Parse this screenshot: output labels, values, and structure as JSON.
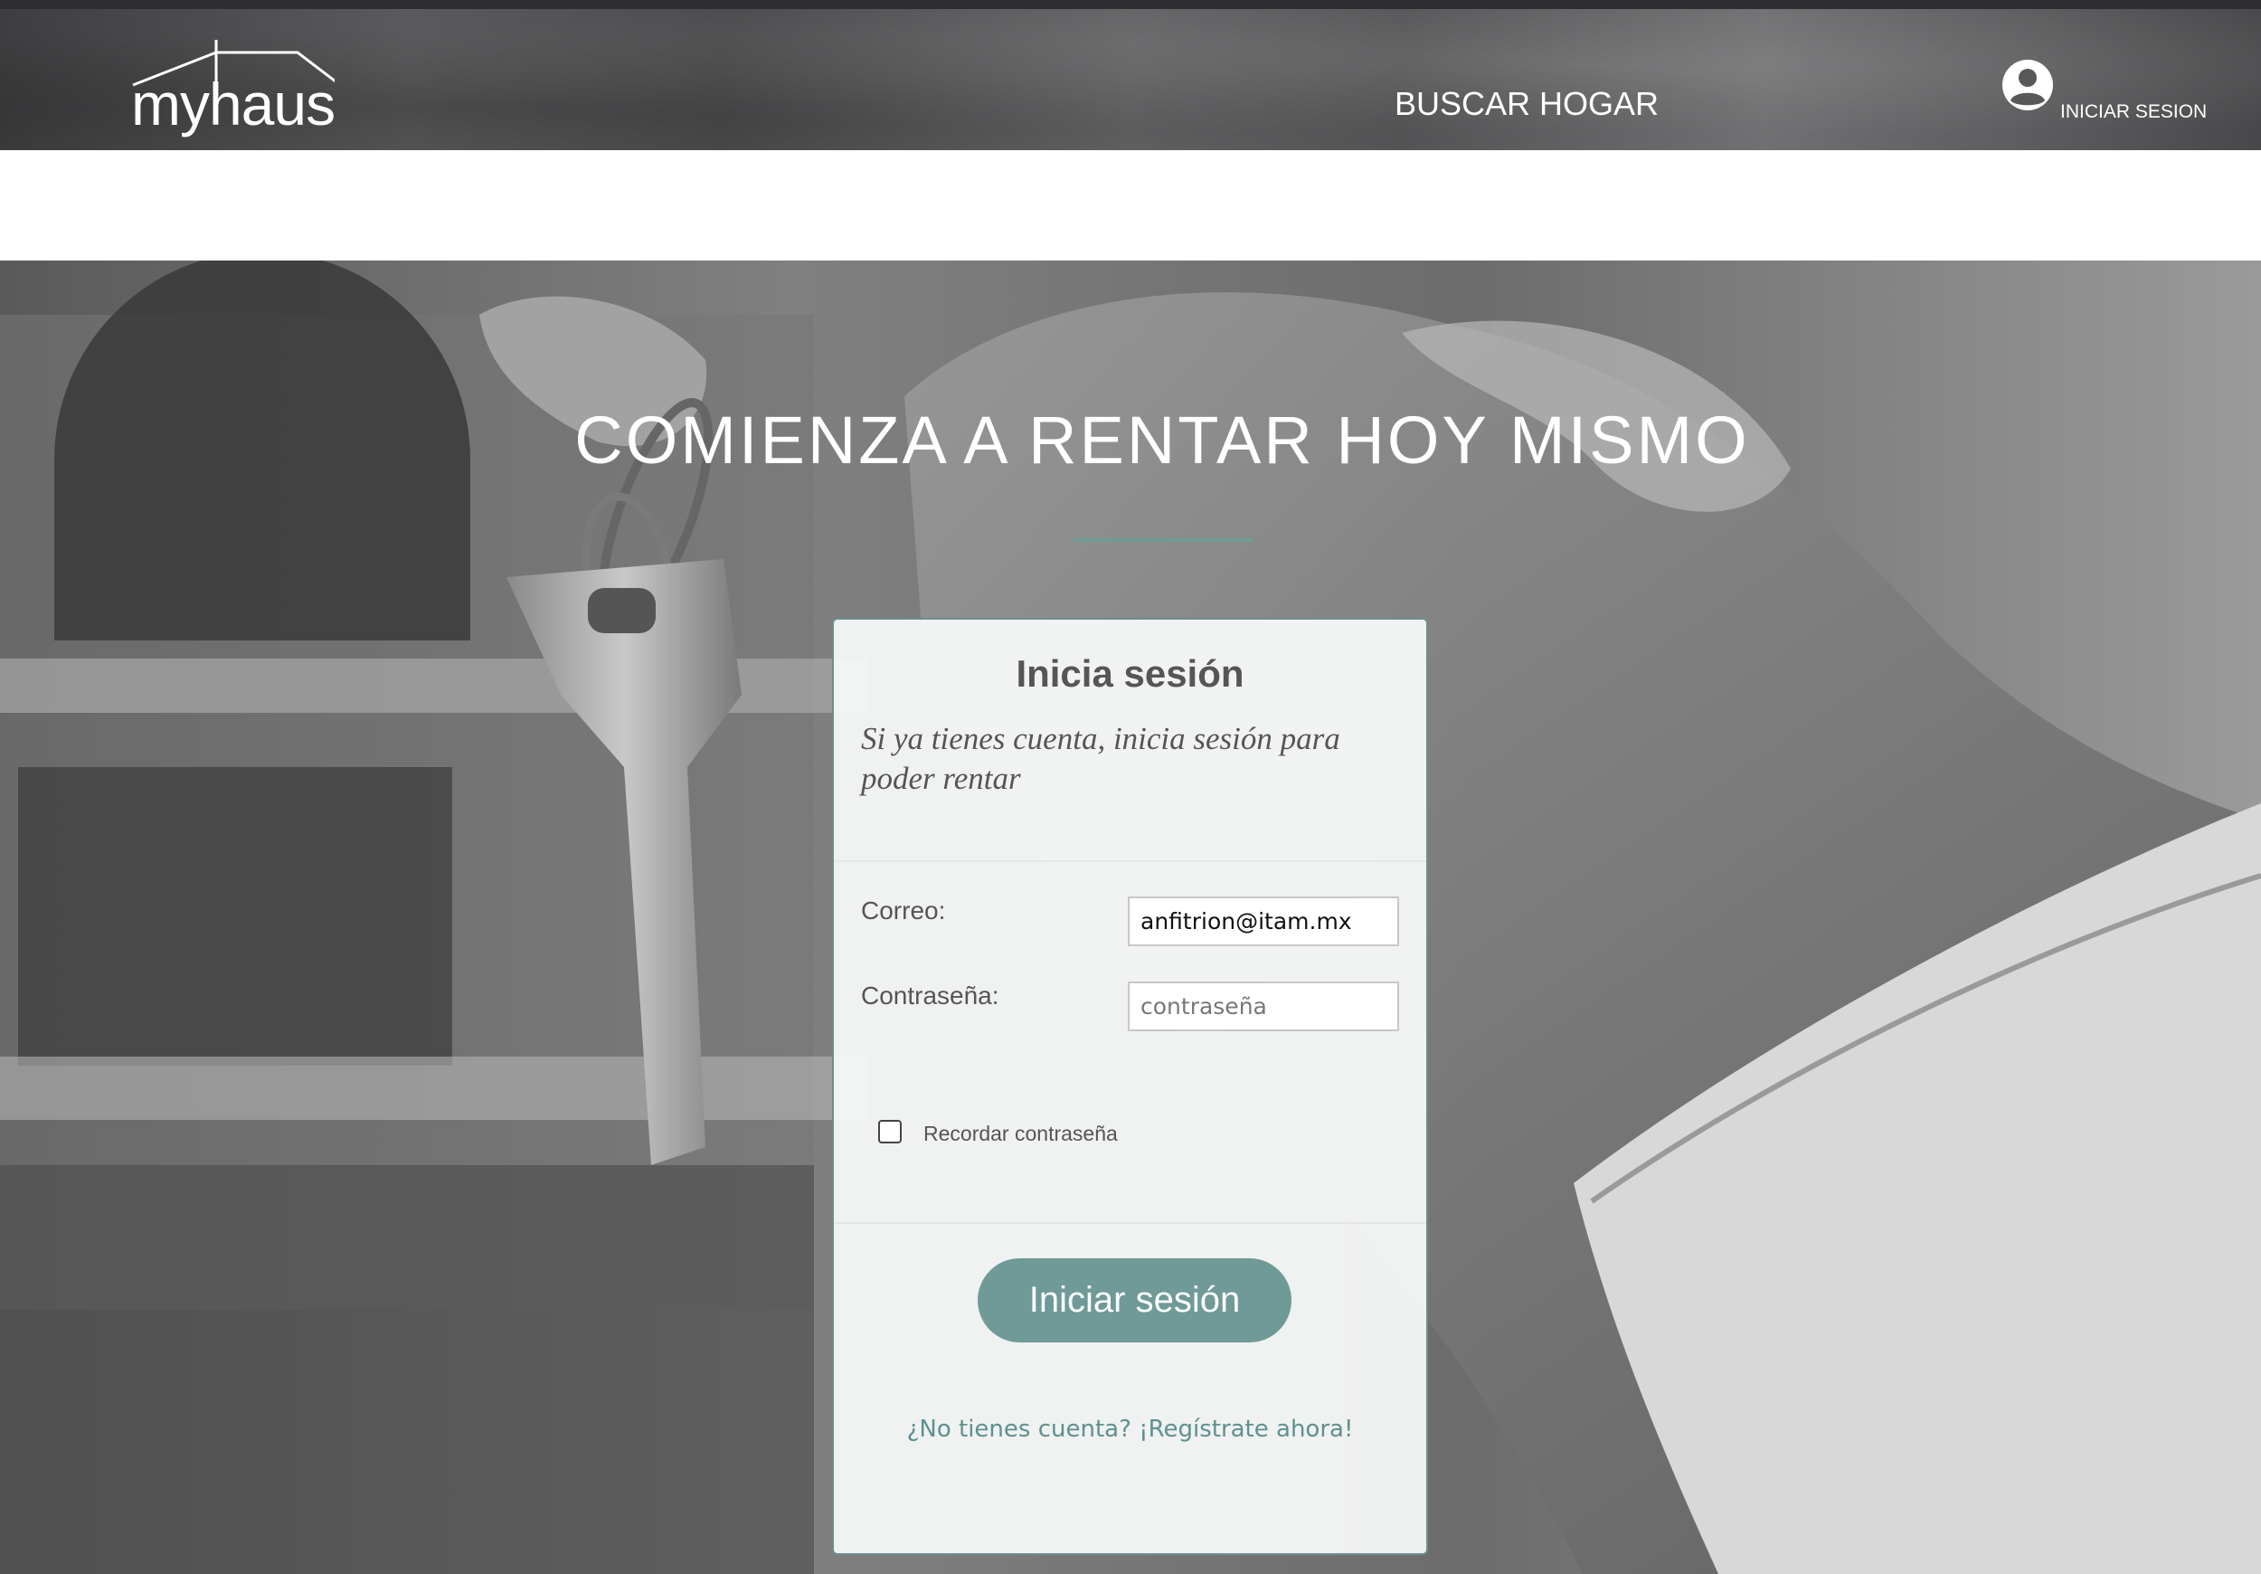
{
  "header": {
    "logo_text": "myhaus",
    "nav_link": "BUSCAR HOGAR",
    "user_link": "INICIAR SESION",
    "user_icon": "user-circle-icon"
  },
  "hero": {
    "title": "COMIENZA A RENTAR HOY MISMO"
  },
  "login": {
    "title": "Inicia sesión",
    "subtitle": "Si ya tienes cuenta, inicia sesión para poder rentar",
    "email_label": "Correo:",
    "email_value": "anfitrion@itam.mx",
    "password_label": "Contraseña:",
    "password_placeholder": "contraseña",
    "remember_label": "Recordar contraseña",
    "remember_checked": false,
    "submit_label": "Iniciar sesión",
    "register_link": "¿No tienes cuenta? ¡Regístrate ahora!"
  },
  "colors": {
    "accent": "#6f9a97",
    "link": "#5e918e",
    "navbar": "#555557"
  }
}
